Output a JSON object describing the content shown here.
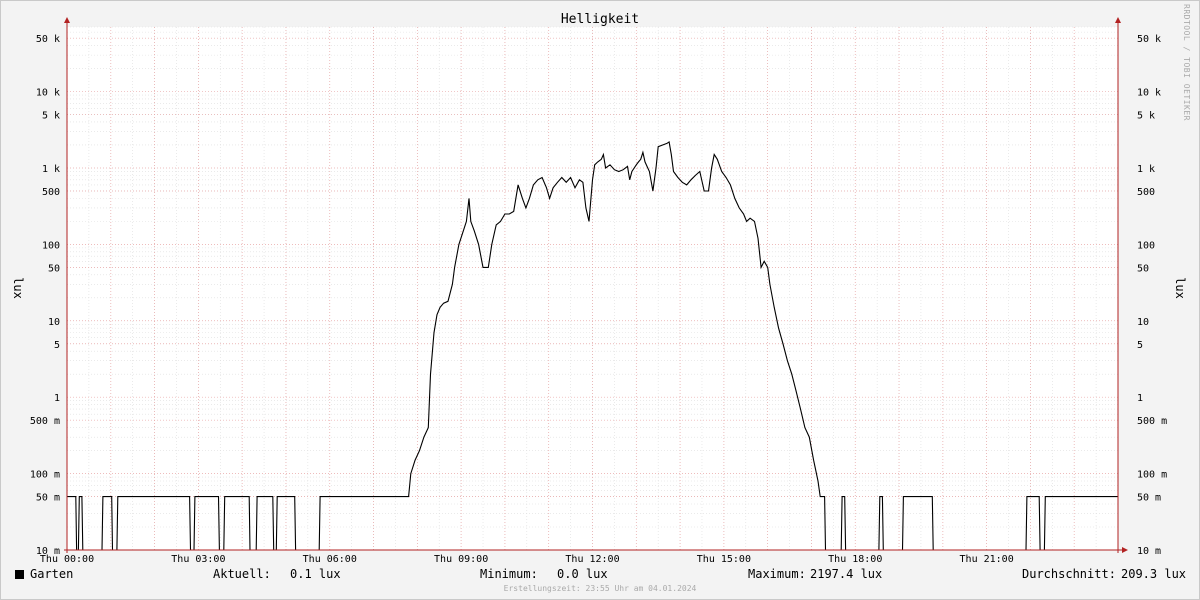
{
  "chart_data": {
    "type": "line",
    "title": "Helligkeit",
    "ylabel": "lux",
    "yscale": "log",
    "ylim": [
      0.01,
      70000
    ],
    "y_ticks": [
      {
        "value": 50000,
        "label": "50 k"
      },
      {
        "value": 10000,
        "label": "10 k"
      },
      {
        "value": 5000,
        "label": "5 k"
      },
      {
        "value": 1000,
        "label": "1 k"
      },
      {
        "value": 500,
        "label": "500"
      },
      {
        "value": 100,
        "label": "100"
      },
      {
        "value": 50,
        "label": "50"
      },
      {
        "value": 10,
        "label": "10"
      },
      {
        "value": 5,
        "label": "5"
      },
      {
        "value": 1,
        "label": "1"
      },
      {
        "value": 0.5,
        "label": "500 m"
      },
      {
        "value": 0.1,
        "label": "100 m"
      },
      {
        "value": 0.05,
        "label": "50 m"
      },
      {
        "value": 0.01,
        "label": "10 m"
      }
    ],
    "x_ticks": [
      {
        "hour": 0,
        "label": "Thu 00:00"
      },
      {
        "hour": 3,
        "label": "Thu 03:00"
      },
      {
        "hour": 6,
        "label": "Thu 06:00"
      },
      {
        "hour": 9,
        "label": "Thu 09:00"
      },
      {
        "hour": 12,
        "label": "Thu 12:00"
      },
      {
        "hour": 15,
        "label": "Thu 15:00"
      },
      {
        "hour": 18,
        "label": "Thu 18:00"
      },
      {
        "hour": 21,
        "label": "Thu 21:00"
      }
    ],
    "xlim_hours": [
      0,
      24
    ],
    "grid": true,
    "series": [
      {
        "name": "Garten",
        "color": "#000000",
        "points": [
          [
            0.0,
            0.05
          ],
          [
            0.2,
            0.05
          ],
          [
            0.22,
            0.01
          ],
          [
            0.26,
            0.01
          ],
          [
            0.28,
            0.05
          ],
          [
            0.34,
            0.05
          ],
          [
            0.36,
            0.01
          ],
          [
            0.8,
            0.01
          ],
          [
            0.82,
            0.05
          ],
          [
            1.02,
            0.05
          ],
          [
            1.04,
            0.01
          ],
          [
            1.14,
            0.01
          ],
          [
            1.16,
            0.05
          ],
          [
            2.8,
            0.05
          ],
          [
            2.82,
            0.01
          ],
          [
            2.9,
            0.01
          ],
          [
            2.92,
            0.05
          ],
          [
            3.46,
            0.05
          ],
          [
            3.48,
            0.01
          ],
          [
            3.58,
            0.01
          ],
          [
            3.6,
            0.05
          ],
          [
            4.16,
            0.05
          ],
          [
            4.18,
            0.01
          ],
          [
            4.32,
            0.01
          ],
          [
            4.34,
            0.05
          ],
          [
            4.7,
            0.05
          ],
          [
            4.72,
            0.01
          ],
          [
            4.78,
            0.01
          ],
          [
            4.8,
            0.05
          ],
          [
            5.2,
            0.05
          ],
          [
            5.22,
            0.01
          ],
          [
            5.76,
            0.01
          ],
          [
            5.78,
            0.05
          ],
          [
            7.8,
            0.05
          ],
          [
            7.85,
            0.1
          ],
          [
            7.95,
            0.15
          ],
          [
            8.05,
            0.2
          ],
          [
            8.15,
            0.3
          ],
          [
            8.25,
            0.4
          ],
          [
            8.3,
            2
          ],
          [
            8.38,
            7
          ],
          [
            8.45,
            12
          ],
          [
            8.52,
            15
          ],
          [
            8.6,
            17
          ],
          [
            8.7,
            18
          ],
          [
            8.8,
            30
          ],
          [
            8.85,
            50
          ],
          [
            8.95,
            100
          ],
          [
            9.05,
            150
          ],
          [
            9.12,
            200
          ],
          [
            9.18,
            400
          ],
          [
            9.22,
            200
          ],
          [
            9.3,
            150
          ],
          [
            9.4,
            100
          ],
          [
            9.5,
            50
          ],
          [
            9.62,
            50
          ],
          [
            9.7,
            100
          ],
          [
            9.8,
            180
          ],
          [
            9.9,
            200
          ],
          [
            10.0,
            250
          ],
          [
            10.1,
            250
          ],
          [
            10.2,
            270
          ],
          [
            10.3,
            600
          ],
          [
            10.4,
            400
          ],
          [
            10.48,
            300
          ],
          [
            10.56,
            400
          ],
          [
            10.65,
            600
          ],
          [
            10.75,
            700
          ],
          [
            10.85,
            750
          ],
          [
            10.95,
            550
          ],
          [
            11.02,
            400
          ],
          [
            11.1,
            550
          ],
          [
            11.2,
            650
          ],
          [
            11.3,
            750
          ],
          [
            11.4,
            650
          ],
          [
            11.5,
            750
          ],
          [
            11.6,
            550
          ],
          [
            11.7,
            700
          ],
          [
            11.78,
            650
          ],
          [
            11.85,
            300
          ],
          [
            11.92,
            200
          ],
          [
            12.0,
            700
          ],
          [
            12.05,
            1100
          ],
          [
            12.12,
            1200
          ],
          [
            12.2,
            1300
          ],
          [
            12.25,
            1500
          ],
          [
            12.3,
            1000
          ],
          [
            12.4,
            1100
          ],
          [
            12.5,
            950
          ],
          [
            12.6,
            900
          ],
          [
            12.7,
            950
          ],
          [
            12.8,
            1050
          ],
          [
            12.85,
            700
          ],
          [
            12.9,
            900
          ],
          [
            13.0,
            1100
          ],
          [
            13.05,
            1200
          ],
          [
            13.1,
            1300
          ],
          [
            13.15,
            1600
          ],
          [
            13.2,
            1200
          ],
          [
            13.3,
            900
          ],
          [
            13.38,
            500
          ],
          [
            13.45,
            1000
          ],
          [
            13.5,
            1900
          ],
          [
            13.6,
            2000
          ],
          [
            13.7,
            2100
          ],
          [
            13.75,
            2197
          ],
          [
            13.8,
            1500
          ],
          [
            13.85,
            900
          ],
          [
            13.95,
            750
          ],
          [
            14.05,
            650
          ],
          [
            14.15,
            600
          ],
          [
            14.25,
            700
          ],
          [
            14.35,
            800
          ],
          [
            14.45,
            900
          ],
          [
            14.55,
            500
          ],
          [
            14.65,
            500
          ],
          [
            14.72,
            1000
          ],
          [
            14.78,
            1500
          ],
          [
            14.85,
            1300
          ],
          [
            14.95,
            900
          ],
          [
            15.05,
            750
          ],
          [
            15.15,
            600
          ],
          [
            15.25,
            400
          ],
          [
            15.35,
            300
          ],
          [
            15.45,
            250
          ],
          [
            15.52,
            200
          ],
          [
            15.6,
            220
          ],
          [
            15.7,
            200
          ],
          [
            15.78,
            120
          ],
          [
            15.85,
            50
          ],
          [
            15.92,
            60
          ],
          [
            16.0,
            50
          ],
          [
            16.05,
            30
          ],
          [
            16.15,
            15
          ],
          [
            16.25,
            8
          ],
          [
            16.35,
            5
          ],
          [
            16.45,
            3
          ],
          [
            16.55,
            2
          ],
          [
            16.65,
            1.2
          ],
          [
            16.75,
            0.7
          ],
          [
            16.85,
            0.4
          ],
          [
            16.95,
            0.3
          ],
          [
            17.05,
            0.15
          ],
          [
            17.15,
            0.08
          ],
          [
            17.2,
            0.05
          ],
          [
            17.3,
            0.05
          ],
          [
            17.32,
            0.01
          ],
          [
            17.68,
            0.01
          ],
          [
            17.7,
            0.05
          ],
          [
            17.76,
            0.05
          ],
          [
            17.78,
            0.01
          ],
          [
            18.54,
            0.01
          ],
          [
            18.56,
            0.05
          ],
          [
            18.62,
            0.05
          ],
          [
            18.64,
            0.01
          ],
          [
            19.08,
            0.01
          ],
          [
            19.1,
            0.05
          ],
          [
            19.76,
            0.05
          ],
          [
            19.78,
            0.01
          ],
          [
            21.9,
            0.01
          ],
          [
            21.92,
            0.05
          ],
          [
            22.2,
            0.05
          ],
          [
            22.22,
            0.01
          ],
          [
            22.32,
            0.01
          ],
          [
            22.34,
            0.05
          ],
          [
            24.0,
            0.05
          ]
        ]
      }
    ]
  },
  "legend": {
    "series_name": "Garten",
    "current_label": "Aktuell:",
    "current_value": "0.1 lux",
    "min_label": "Minimum:",
    "min_value": "0.0 lux",
    "max_label": "Maximum:",
    "max_value": "2197.4 lux",
    "avg_label": "Durchschnitt:",
    "avg_value": "209.3 lux"
  },
  "footer": "Erstellungszeit: 23:55 Uhr am 04.01.2024",
  "watermark": "RRDTOOL / TOBI OETIKER",
  "colors": {
    "background": "#f3f3f3",
    "plot_background": "#ffffff",
    "major_grid": "#e8a6a6",
    "minor_grid": "#dddddd",
    "axis": "#b22222",
    "line": "#000000"
  }
}
